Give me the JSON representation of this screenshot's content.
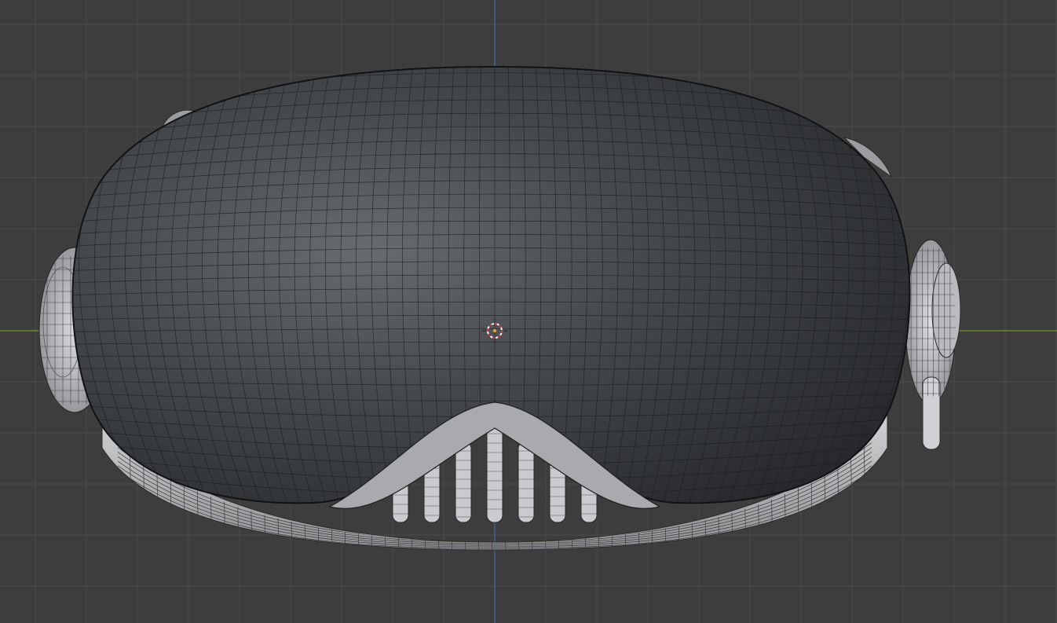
{
  "app": "3D viewport",
  "view": {
    "background_color": "#3d3d3d",
    "grid_color": "#4a4a4a",
    "x_axis_color": "#6f9a2c",
    "z_axis_color": "#3f6ea0",
    "overlay": "wireframe",
    "shading": "solid"
  },
  "model": {
    "shell_color": "#3a3c40",
    "wire_color": "#1a1b1c",
    "band_color": "#bfc1c3"
  },
  "cursor_3d": {
    "icon": "3d-cursor-icon",
    "ring_color": "#d23b3b"
  }
}
